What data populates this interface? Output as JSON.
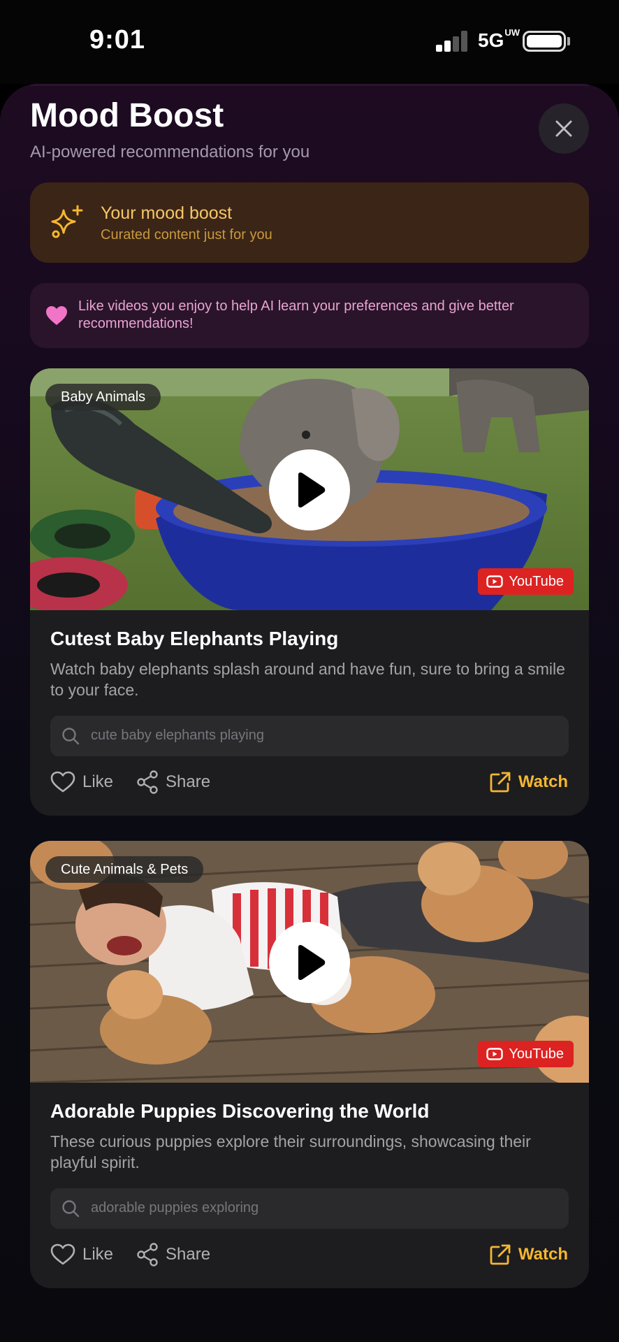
{
  "status_bar": {
    "time": "9:01",
    "network": "5G",
    "network_sup": "UW"
  },
  "header": {
    "title": "Mood Boost",
    "subtitle": "AI-powered recommendations for you"
  },
  "boost_card": {
    "title": "Your mood boost",
    "subtitle": "Curated content just for you",
    "icon": "sparkles-icon"
  },
  "tip": {
    "text": "Like videos you enjoy to help AI learn your preferences and give better recommendations!",
    "icon": "heart-icon"
  },
  "videos": [
    {
      "category": "Baby Animals",
      "platform": "YouTube",
      "title": "Cutest Baby Elephants Playing",
      "description": "Watch baby elephants splash around and have fun, sure to bring a smile to your face.",
      "search_query": "cute baby elephants playing",
      "like_label": "Like",
      "share_label": "Share",
      "watch_label": "Watch"
    },
    {
      "category": "Cute Animals & Pets",
      "platform": "YouTube",
      "title": "Adorable Puppies Discovering the World",
      "description": "These curious puppies explore their surroundings, showcasing their playful spirit.",
      "search_query": "adorable puppies exploring",
      "like_label": "Like",
      "share_label": "Share",
      "watch_label": "Watch"
    }
  ],
  "colors": {
    "accent_gold": "#f5b731",
    "youtube_red": "#dd2222",
    "tip_pink": "#e7a4d0"
  }
}
